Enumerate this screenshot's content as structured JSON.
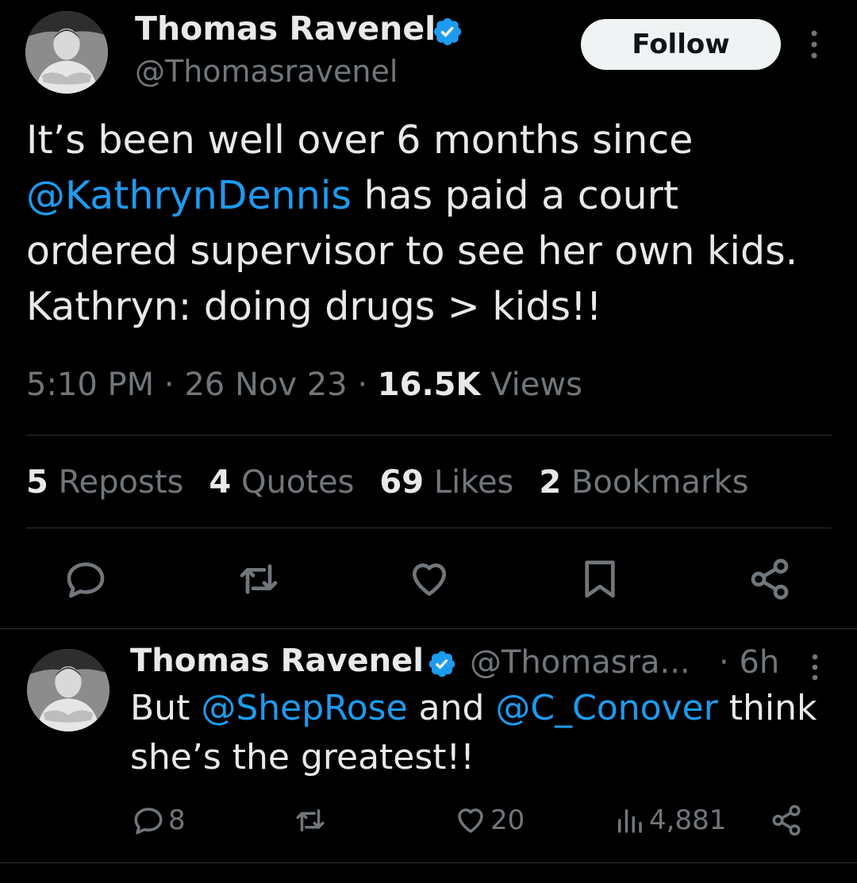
{
  "main_tweet": {
    "author_name": "Thomas Ravenel",
    "author_handle": "@Thomasravenel",
    "follow_label": "Follow",
    "text": {
      "part1": "It’s been well over 6 months since ",
      "mention": "@KathrynDennis",
      "part2": " has paid a court ordered supervisor to see her own kids. Kathryn: doing drugs > kids!!"
    },
    "time": "5:10 PM",
    "date": "26 Nov 23",
    "views_count": "16.5K",
    "views_label": "Views",
    "stats": {
      "reposts": {
        "count": "5",
        "label": "Reposts"
      },
      "quotes": {
        "count": "4",
        "label": "Quotes"
      },
      "likes": {
        "count": "69",
        "label": "Likes"
      },
      "bookmarks": {
        "count": "2",
        "label": "Bookmarks"
      }
    },
    "actions": [
      "reply-icon",
      "repost-icon",
      "like-icon",
      "bookmark-icon",
      "share-icon"
    ]
  },
  "reply": {
    "author_name": "Thomas Ravenel",
    "author_handle": "@Thomasra...",
    "separator": "·",
    "time": "6h",
    "text": {
      "part1": "But ",
      "mention1": "@ShepRose",
      "part2": " and ",
      "mention2": "@C_Conover",
      "part3": " think she’s the greatest!!"
    },
    "reply_count": "8",
    "like_count": "20",
    "view_count": "4,881",
    "actions": [
      "reply-icon",
      "repost-icon",
      "like-icon",
      "views-icon",
      "share-icon"
    ]
  },
  "colors": {
    "background": "#000000",
    "text": "#e7e9ea",
    "secondary": "#71767b",
    "link": "#1d9bf0",
    "verified": "#1d9bf0",
    "divider": "#2f3336"
  }
}
